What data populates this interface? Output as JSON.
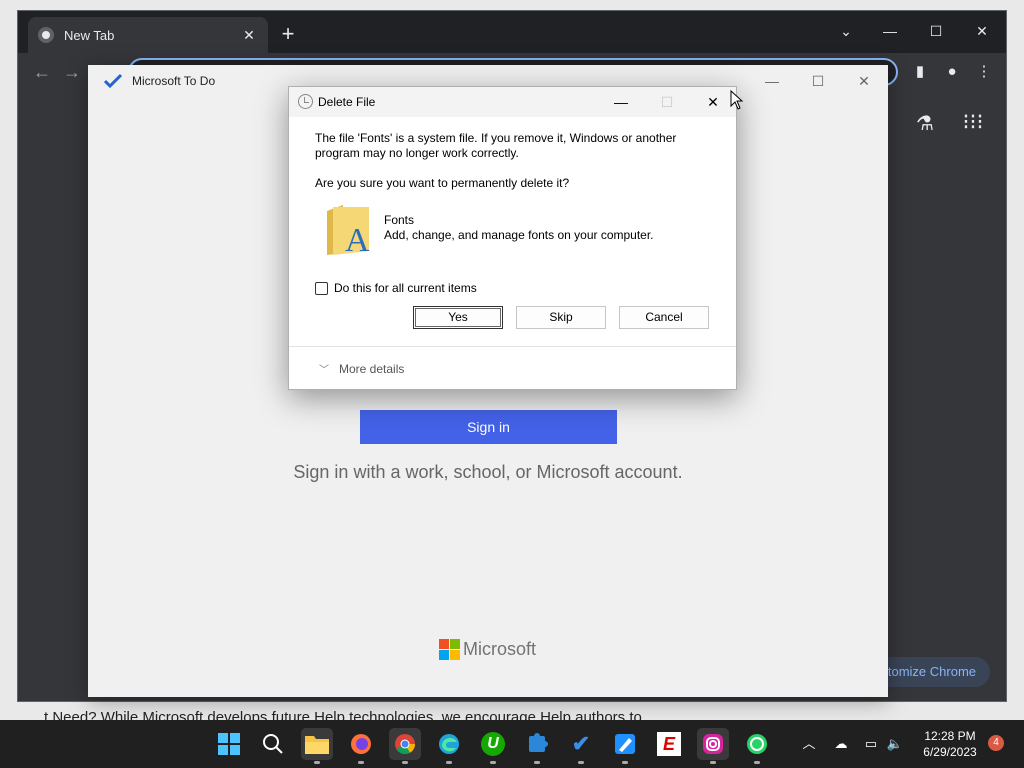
{
  "background_page": {
    "text": "t Need? While Microsoft develops future Help technologies, we encourage Help authors to"
  },
  "chrome": {
    "tab_title": "New Tab",
    "tab_close": "✕",
    "new_tab": "+",
    "customize_label": "stomize Chrome",
    "win": {
      "dropdown": "⌄",
      "minimize": "—",
      "maximize": "☐",
      "close": "✕"
    }
  },
  "todo": {
    "title": "Microsoft To Do",
    "signin_label": "Sign in",
    "signin_desc": "Sign in with a work, school, or Microsoft account.",
    "brand": "Microsoft",
    "colors": {
      "accent": "#4362e8",
      "logo_red": "#f25022",
      "logo_green": "#7fba00",
      "logo_blue": "#00a4ef",
      "logo_yellow": "#ffb900"
    }
  },
  "dialog": {
    "title": "Delete File",
    "message": "The file 'Fonts' is a system file. If you remove it, Windows or another program may no longer work correctly.",
    "question": "Are you sure you want to permanently delete it?",
    "file_name": "Fonts",
    "file_desc": "Add, change, and manage fonts on your computer.",
    "checkbox_label": "Do this for all current items",
    "buttons": {
      "yes": "Yes",
      "skip": "Skip",
      "cancel": "Cancel"
    },
    "more_details": "More details",
    "win": {
      "minimize": "—",
      "maximize": "☐",
      "close": "✕"
    }
  },
  "taskbar": {
    "apps": [
      {
        "name": "start",
        "icon": "windows-icon"
      },
      {
        "name": "search",
        "icon": "search-icon"
      },
      {
        "name": "file-explorer",
        "icon": "folder-icon"
      },
      {
        "name": "firefox",
        "icon": "firefox-icon"
      },
      {
        "name": "chrome",
        "icon": "chrome-icon"
      },
      {
        "name": "edge",
        "icon": "edge-icon"
      },
      {
        "name": "upwork",
        "icon": "upwork-icon",
        "text": "U"
      },
      {
        "name": "teams",
        "icon": "puzzle-icon"
      },
      {
        "name": "to-do",
        "icon": "checkmark-icon",
        "text": "✔"
      },
      {
        "name": "paint",
        "icon": "paint-icon"
      },
      {
        "name": "espn",
        "icon": "espn-icon",
        "text": "E"
      },
      {
        "name": "instagram",
        "icon": "instagram-icon"
      },
      {
        "name": "whatsapp",
        "icon": "whatsapp-icon"
      }
    ],
    "time": "12:28 PM",
    "date": "6/29/2023",
    "notifications": "4"
  }
}
